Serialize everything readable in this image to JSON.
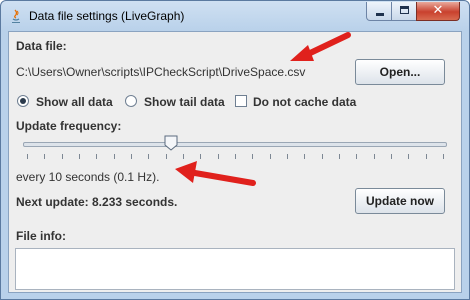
{
  "window": {
    "title": "Data file settings (LiveGraph)",
    "close_glyph": "✕"
  },
  "data_file": {
    "label": "Data file:",
    "path": "C:\\Users\\Owner\\scripts\\IPCheckScript\\DriveSpace.csv",
    "open_button": "Open..."
  },
  "options": {
    "show_all": {
      "label": "Show all data",
      "selected": true
    },
    "show_tail": {
      "label": "Show tail data",
      "selected": false
    },
    "no_cache": {
      "label": "Do not cache data",
      "checked": false
    }
  },
  "update": {
    "label": "Update frequency:",
    "slider_fraction": 0.345,
    "frequency_text": "every 10 seconds (0.1 Hz).",
    "next_update": "Next update: 8.233 seconds.",
    "update_button": "Update now"
  },
  "file_info": {
    "label": "File info:"
  },
  "colors": {
    "annotation_arrow": "#e0211c"
  }
}
